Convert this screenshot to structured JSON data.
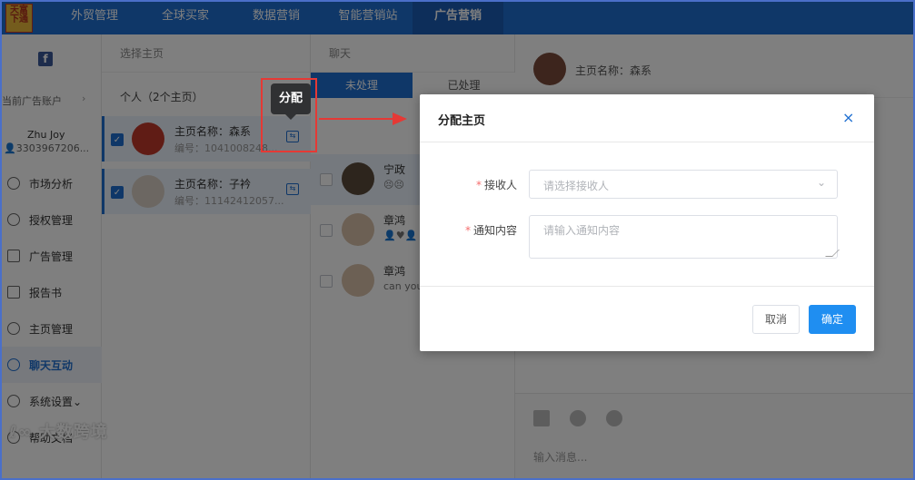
{
  "logo": {
    "text": "天富下通"
  },
  "topnav": {
    "items": [
      {
        "label": "外贸管理"
      },
      {
        "label": "全球买家"
      },
      {
        "label": "数据营销"
      },
      {
        "label": "智能营销站"
      },
      {
        "label": "广告营销"
      }
    ],
    "active_index": 4
  },
  "sidebar": {
    "facebook_icon": "facebook-icon",
    "account_switch_label": "当前广告账户",
    "user_name": "Zhu Joy",
    "user_id": "3303967206...",
    "menu": [
      {
        "label": "市场分析",
        "icon": "globe-icon"
      },
      {
        "label": "授权管理",
        "icon": "user-icon"
      },
      {
        "label": "广告管理",
        "icon": "ad-icon"
      },
      {
        "label": "报告书",
        "icon": "report-icon"
      },
      {
        "label": "主页管理",
        "icon": "share-icon"
      },
      {
        "label": "聊天互动",
        "icon": "chat-icon"
      },
      {
        "label": "系统设置",
        "icon": "settings-icon",
        "chevron": "⌄"
      },
      {
        "label": "帮助文档",
        "icon": "help-icon"
      }
    ],
    "active_menu": "聊天互动"
  },
  "watermark": "大数跨境",
  "pages_panel": {
    "header": "选择主页",
    "group_label": "个人（2个主页）",
    "pages": [
      {
        "name": "主页名称：森系",
        "number": "编号：1041008248...",
        "checked": true
      },
      {
        "name": "主页名称：子衿",
        "number": "编号：11142412057...",
        "checked": true
      }
    ]
  },
  "chat_panel": {
    "header": "聊天",
    "tabs": [
      {
        "label": "未处理"
      },
      {
        "label": "已处理"
      }
    ],
    "active_tab": 0,
    "chats": [
      {
        "name": "宁政",
        "message": "😣😣"
      },
      {
        "name": "章鸿",
        "message": "👤♥👤"
      },
      {
        "name": "章鸿",
        "message": "can you"
      }
    ]
  },
  "conversation": {
    "title": "主页名称：森系",
    "input_placeholder": "输入消息..."
  },
  "tooltip": {
    "text": "分配"
  },
  "dialog": {
    "title": "分配主页",
    "close_icon": "×",
    "fields": [
      {
        "label": "接收人",
        "required": true,
        "placeholder": "请选择接收人",
        "type": "select"
      },
      {
        "label": "通知内容",
        "required": true,
        "placeholder": "请输入通知内容",
        "type": "textarea"
      }
    ],
    "cancel_label": "取消",
    "confirm_label": "确定"
  },
  "colors": {
    "primary": "#1f6fd1",
    "annotation_red": "#e53935",
    "required_star": "#f56c6c"
  }
}
